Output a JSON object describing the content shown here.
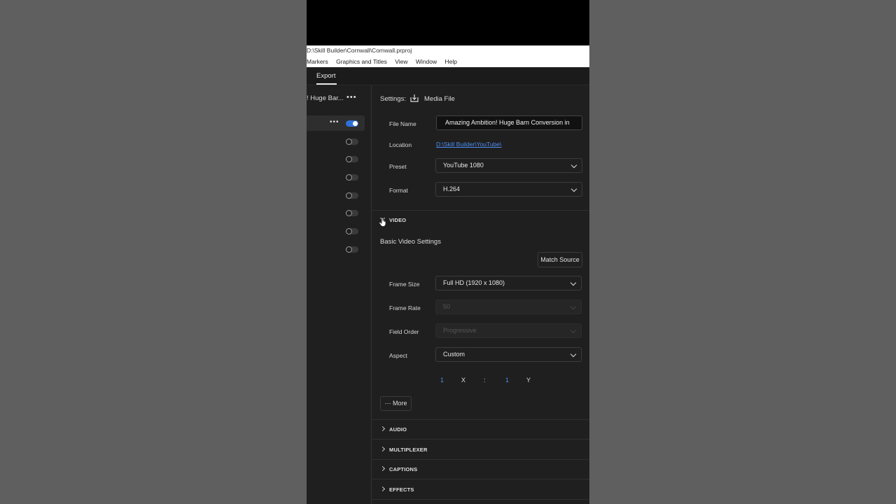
{
  "window": {
    "title_path": "D:\\Skill Builder\\Cornwall\\Cornwall.prproj"
  },
  "menu": {
    "items": [
      "Markers",
      "Graphics and Titles",
      "View",
      "Window",
      "Help"
    ]
  },
  "tabs": {
    "active": "Export"
  },
  "queue": {
    "title": "! Huge Bar...",
    "toggles": [
      true,
      false,
      false,
      false,
      false,
      false,
      false,
      false
    ]
  },
  "settings": {
    "label": "Settings:",
    "destination": "Media File",
    "file_name_label": "File Name",
    "file_name_value": "Amazing Ambition! Huge Barn Conversion in",
    "location_label": "Location",
    "location_value": "D:\\Skill Builder\\YouTube\\",
    "preset_label": "Preset",
    "preset_value": "YouTube 1080",
    "format_label": "Format",
    "format_value": "H.264"
  },
  "video": {
    "section_label": "VIDEO",
    "basic_label": "Basic Video Settings",
    "match_source": "Match Source",
    "frame_size_label": "Frame Size",
    "frame_size_value": "Full HD (1920 x 1080)",
    "frame_rate_label": "Frame Rate",
    "frame_rate_value": "50",
    "field_order_label": "Field Order",
    "field_order_value": "Progressive",
    "aspect_label": "Aspect",
    "aspect_value": "Custom",
    "aspect_x_num": "1",
    "aspect_x_label": "X",
    "aspect_sep": ":",
    "aspect_y_num": "1",
    "aspect_y_label": "Y",
    "more_label": "More"
  },
  "sections": [
    "AUDIO",
    "MULTIPLEXER",
    "CAPTIONS",
    "EFFECTS"
  ],
  "colors": {
    "accent": "#2f6fd8",
    "link": "#4c8ef2",
    "panel_bg": "#1f1f1f"
  }
}
